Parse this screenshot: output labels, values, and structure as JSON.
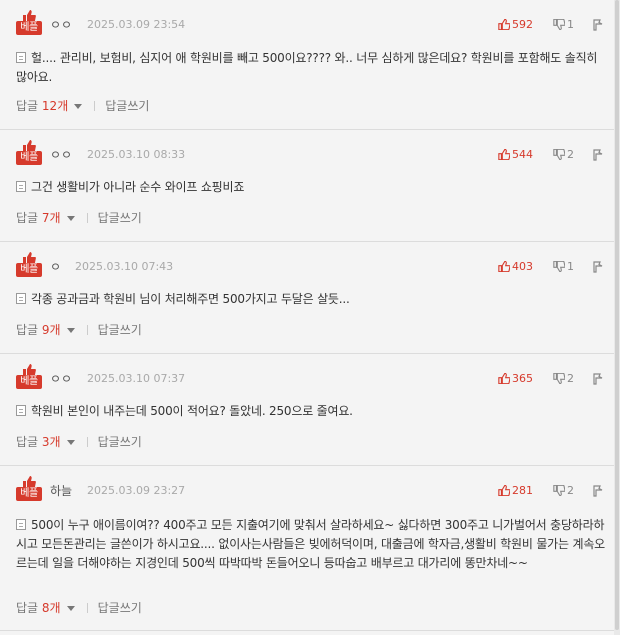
{
  "comments": [
    {
      "badge": "베플",
      "nickname": "ㅇㅇ",
      "date": "2025.03.09 23:54",
      "likes": "592",
      "dislikes": "1",
      "text": "헐.... 관리비, 보험비, 심지어 애 학원비를 빼고 500이요???? 와.. 너무 심하게 많은데요? 학원비를 포함해도 솔직히 많아요.",
      "reply_label": "답글",
      "reply_count": "12개",
      "write_label": "답글쓰기"
    },
    {
      "badge": "베플",
      "nickname": "ㅇㅇ",
      "date": "2025.03.10 08:33",
      "likes": "544",
      "dislikes": "2",
      "text": "그건 생활비가 아니라 순수 와이프 쇼핑비죠",
      "reply_label": "답글",
      "reply_count": "7개",
      "write_label": "답글쓰기"
    },
    {
      "badge": "베플",
      "nickname": "ㅇ",
      "date": "2025.03.10 07:43",
      "likes": "403",
      "dislikes": "1",
      "text": "각종 공과금과 학원비 님이 처리해주면 500가지고 두달은 살듯...",
      "reply_label": "답글",
      "reply_count": "9개",
      "write_label": "답글쓰기"
    },
    {
      "badge": "베플",
      "nickname": "ㅇㅇ",
      "date": "2025.03.10 07:37",
      "likes": "365",
      "dislikes": "2",
      "text": "학원비 본인이 내주는데 500이 적어요? 돌았네. 250으로 줄여요.",
      "reply_label": "답글",
      "reply_count": "3개",
      "write_label": "답글쓰기"
    },
    {
      "badge": "베플",
      "nickname": "하늘",
      "date": "2025.03.09 23:27",
      "likes": "281",
      "dislikes": "2",
      "text": "500이 누구 애이름이여?? 400주고 모든 지출여기에 맞춰서 살라하세요~ 싫다하면 300주고 니가벌어서 충당하라하시고 모든돈관리는 글쓴이가 하시고요.... 없이사는사람들은 빚에허덕이며, 대출금에 학자금,생활비 학원비 물가는 계속오르는데 일을 더해야하는 지경인데 500씩 따박따박 돈들어오니 등따숩고 배부르고 대가리에 똥만차네~~",
      "reply_label": "답글",
      "reply_count": "8개",
      "write_label": "답글쓰기"
    }
  ]
}
